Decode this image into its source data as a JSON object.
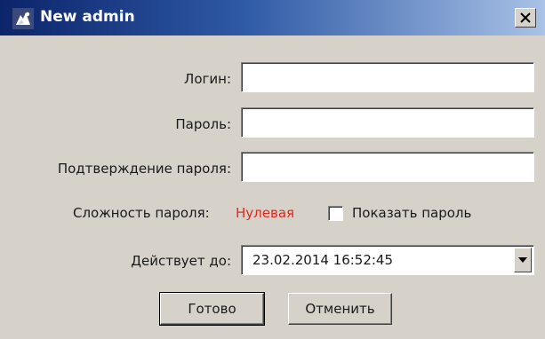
{
  "window": {
    "title": "New admin",
    "app_icon": "app-logo-icon",
    "close_icon": "close-icon"
  },
  "form": {
    "login_label": "Логин:",
    "login_value": "",
    "password_label": "Пароль:",
    "password_value": "",
    "confirm_label": "Подтверждение пароля:",
    "confirm_value": "",
    "complexity_label": "Сложность пароля:",
    "complexity_value": "Нулевая",
    "complexity_color": "#e0281e",
    "show_password_label": "Показать пароль",
    "show_password_checked": false,
    "valid_until_label": "Действует до:",
    "valid_until_value": "23.02.2014 16:52:45"
  },
  "buttons": {
    "ok_label": "Готово",
    "cancel_label": "Отменить"
  },
  "colors": {
    "title_start": "#0c246a",
    "title_end": "#a9c2e6",
    "dialog_bg": "#d6d2ca"
  }
}
